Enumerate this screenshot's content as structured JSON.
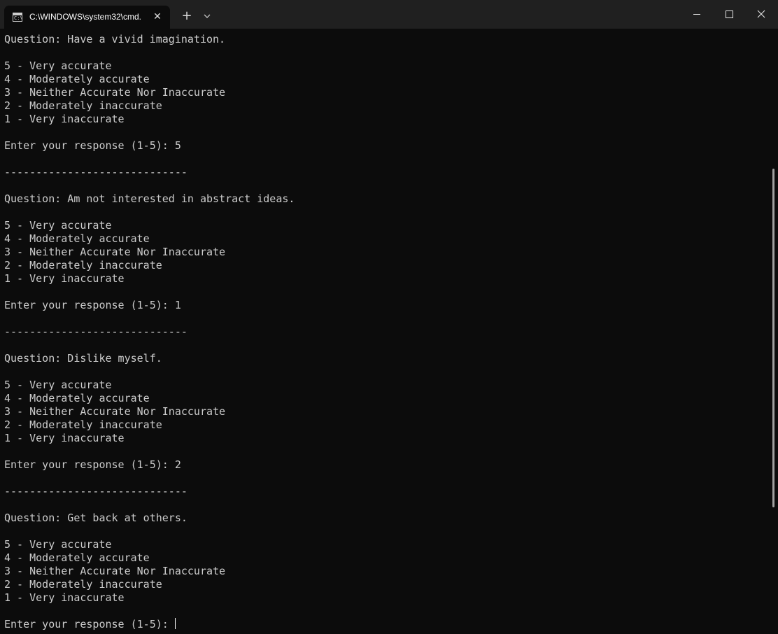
{
  "window": {
    "tab_title": "C:\\WINDOWS\\system32\\cmd.",
    "icons": {
      "tab": "cmd-terminal-icon",
      "tab_close": "close-icon",
      "new_tab": "plus-icon",
      "dropdown": "chevron-down-icon",
      "minimize": "minimize-icon",
      "maximize": "maximize-icon",
      "close": "close-icon"
    }
  },
  "console": {
    "lines": [
      "Question: Have a vivid imagination.",
      "",
      "5 - Very accurate",
      "4 - Moderately accurate",
      "3 - Neither Accurate Nor Inaccurate",
      "2 - Moderately inaccurate",
      "1 - Very inaccurate",
      "",
      "Enter your response (1-5): 5",
      "",
      "-----------------------------",
      "",
      "Question: Am not interested in abstract ideas.",
      "",
      "5 - Very accurate",
      "4 - Moderately accurate",
      "3 - Neither Accurate Nor Inaccurate",
      "2 - Moderately inaccurate",
      "1 - Very inaccurate",
      "",
      "Enter your response (1-5): 1",
      "",
      "-----------------------------",
      "",
      "Question: Dislike myself.",
      "",
      "5 - Very accurate",
      "4 - Moderately accurate",
      "3 - Neither Accurate Nor Inaccurate",
      "2 - Moderately inaccurate",
      "1 - Very inaccurate",
      "",
      "Enter your response (1-5): 2",
      "",
      "-----------------------------",
      "",
      "Question: Get back at others.",
      "",
      "5 - Very accurate",
      "4 - Moderately accurate",
      "3 - Neither Accurate Nor Inaccurate",
      "2 - Moderately inaccurate",
      "1 - Very inaccurate",
      ""
    ],
    "prompt": "Enter your response (1-5): "
  },
  "colors": {
    "background": "#0c0c0c",
    "titlebar": "#202020",
    "text": "#cccccc"
  }
}
